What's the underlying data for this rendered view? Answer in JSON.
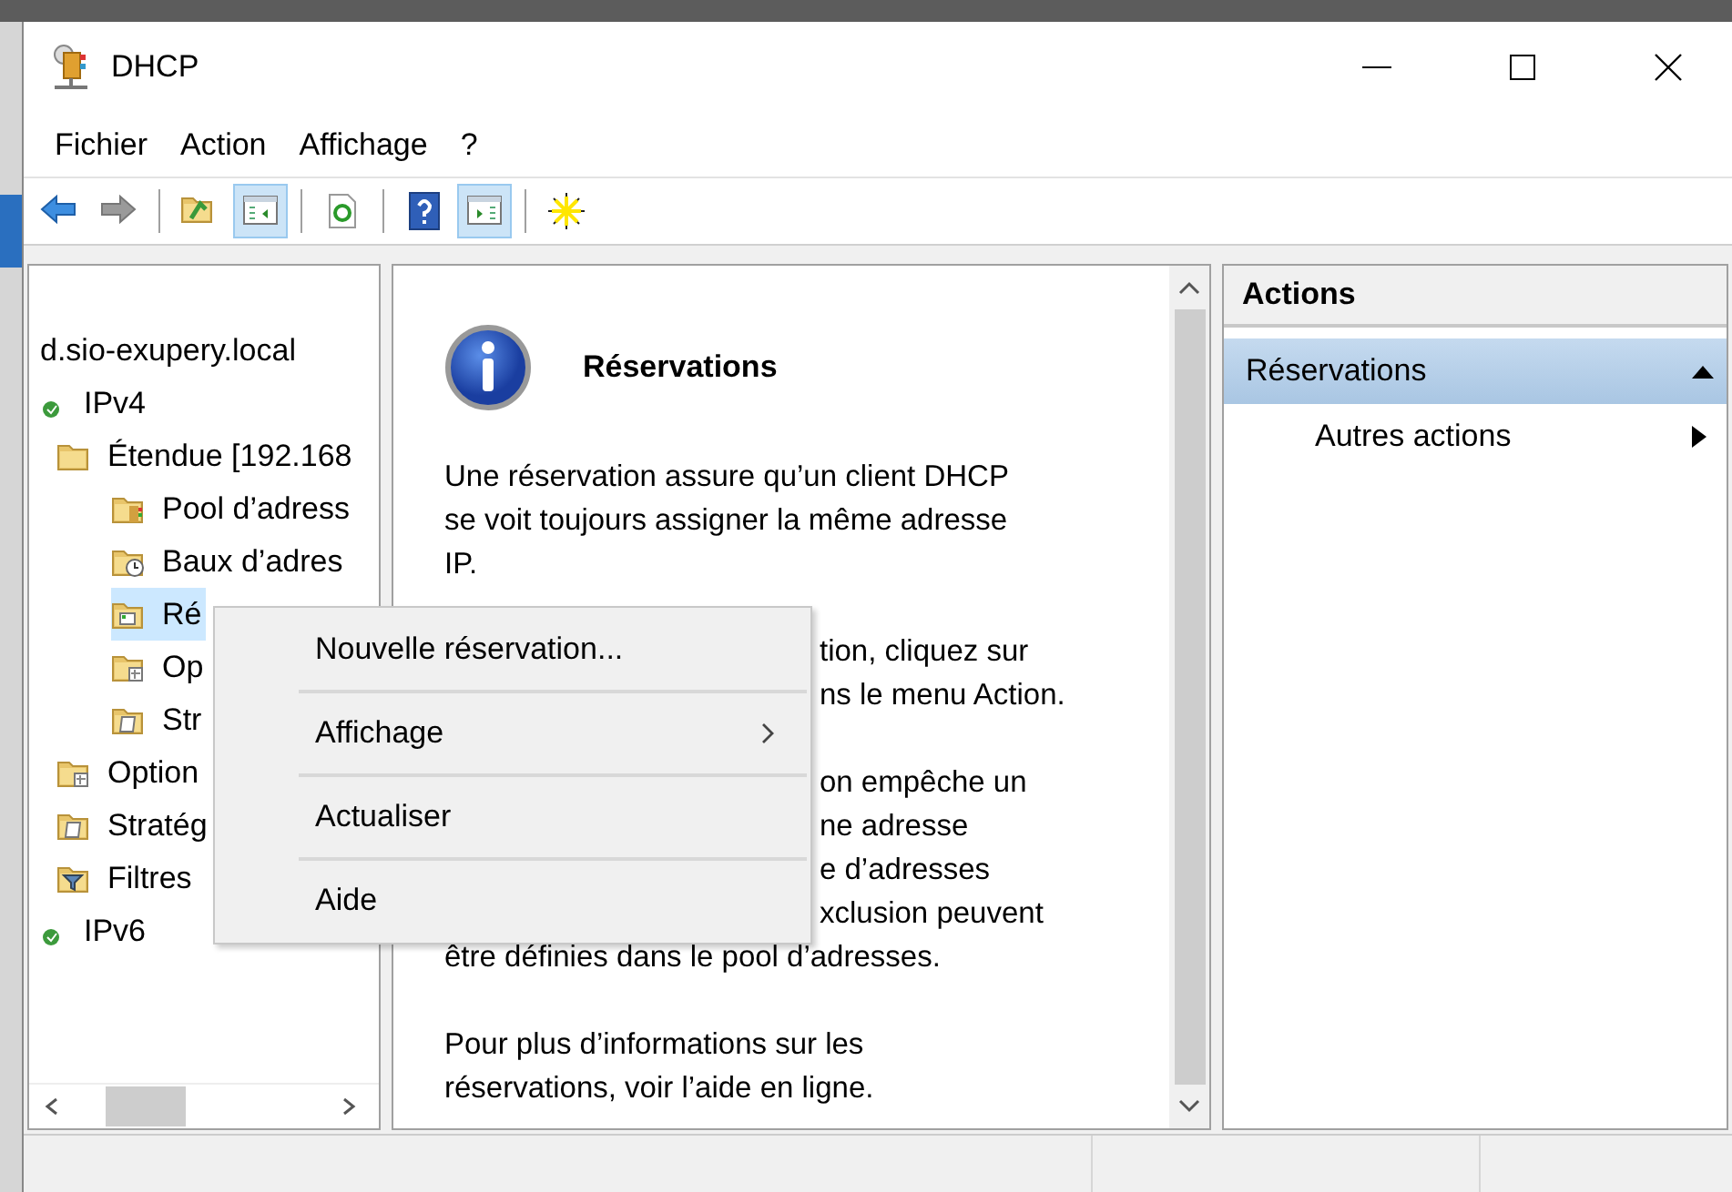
{
  "window": {
    "title": "DHCP"
  },
  "menu_bar": [
    {
      "label": "Fichier"
    },
    {
      "label": "Action"
    },
    {
      "label": "Affichage"
    },
    {
      "label": "?"
    }
  ],
  "toolbar": [
    {
      "kind": "back",
      "pressed": false
    },
    {
      "kind": "forward",
      "pressed": false
    },
    {
      "kind": "separator"
    },
    {
      "kind": "up",
      "pressed": false
    },
    {
      "kind": "tree",
      "pressed": true
    },
    {
      "kind": "separator"
    },
    {
      "kind": "refresh",
      "pressed": false
    },
    {
      "kind": "separator"
    },
    {
      "kind": "help",
      "pressed": false
    },
    {
      "kind": "actionpane",
      "pressed": true
    },
    {
      "kind": "separator"
    },
    {
      "kind": "new",
      "pressed": false
    }
  ],
  "tree": {
    "items": [
      {
        "label": "d.sio-exupery.local",
        "kind": "server",
        "selected": false
      },
      {
        "label": "IPv4",
        "kind": "ip",
        "selected": false,
        "children": [
          {
            "label": "Étendue [192.168",
            "kind": "folder",
            "selected": false,
            "children": [
              {
                "label": "Pool d’adress",
                "kind": "pool",
                "selected": false
              },
              {
                "label": "Baux d’adres",
                "kind": "leases",
                "selected": false
              },
              {
                "label": "Ré",
                "kind": "reservations",
                "selected": true
              },
              {
                "label": "Op",
                "kind": "options",
                "selected": false
              },
              {
                "label": "Str",
                "kind": "policy",
                "selected": false
              }
            ]
          },
          {
            "label": "Option",
            "kind": "options",
            "selected": false
          },
          {
            "label": "Stratég",
            "kind": "policy",
            "selected": false
          },
          {
            "label": "Filtres",
            "kind": "filter",
            "selected": false
          }
        ]
      },
      {
        "label": "IPv6",
        "kind": "ip",
        "selected": false
      }
    ]
  },
  "content": {
    "title": "Réservations",
    "paragraphs": [
      {
        "lines": [
          {
            "text": "Une réservation assure qu’un client DHCP",
            "kind": "full"
          },
          {
            "text": "se voit toujours assigner la même adresse",
            "kind": "full"
          },
          {
            "text": "IP.",
            "kind": "full"
          }
        ]
      },
      {
        "lines": [
          {
            "text": "tion, cliquez sur",
            "kind": "tail"
          },
          {
            "text": "ns le menu Action.",
            "kind": "tail"
          }
        ]
      },
      {
        "lines": [
          {
            "text": "on empêche un",
            "kind": "tail"
          },
          {
            "text": "ne adresse",
            "kind": "tail"
          },
          {
            "text": "e d’adresses",
            "kind": "tail"
          },
          {
            "text": "xclusion peuvent",
            "kind": "tail"
          },
          {
            "text": "être définies dans le pool d’adresses.",
            "kind": "full"
          }
        ]
      },
      {
        "lines": [
          {
            "text": "Pour plus d’informations sur les",
            "kind": "full"
          },
          {
            "text": "réservations, voir l’aide en ligne.",
            "kind": "full"
          }
        ]
      }
    ]
  },
  "actions": {
    "title": "Actions",
    "section": {
      "label": "Réservations",
      "expanded": true
    },
    "items": [
      {
        "label": "Autres actions"
      }
    ]
  },
  "context_menu": [
    {
      "label": "Nouvelle réservation...",
      "submenu": false
    },
    {
      "label": "Affichage",
      "submenu": true
    },
    {
      "label": "Actualiser",
      "submenu": false
    },
    {
      "label": "Aide",
      "submenu": false
    }
  ]
}
